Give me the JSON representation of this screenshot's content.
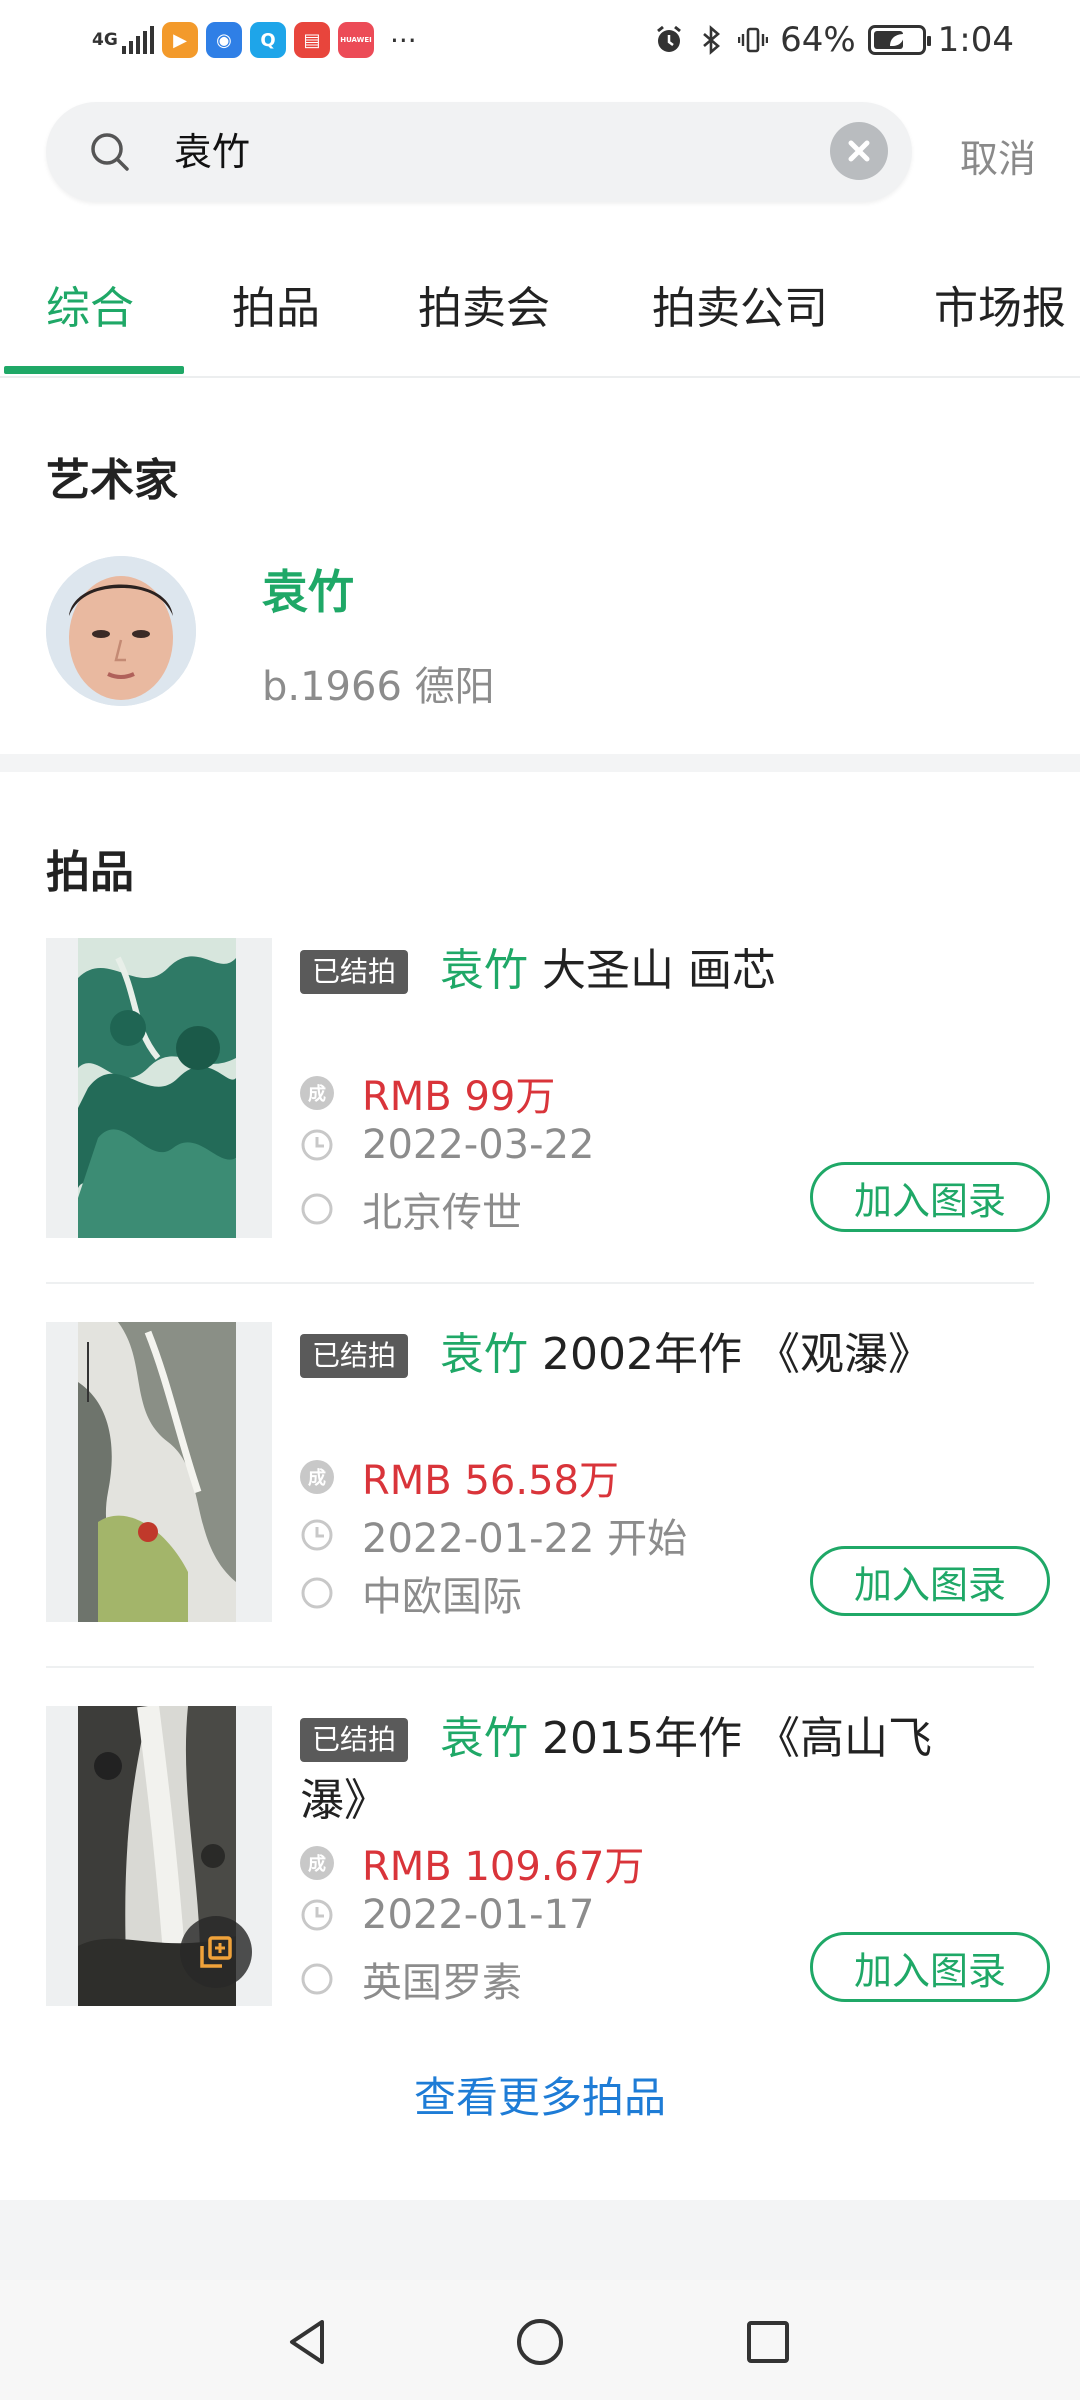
{
  "status_bar": {
    "network": "4G",
    "battery_percent": "64%",
    "battery_level": 0.64,
    "time": "1:04",
    "more": "···",
    "app_icons": [
      "video-app-icon",
      "bulb-app-icon",
      "search-app-icon",
      "reader-app-icon",
      "huawei-app-icon"
    ],
    "app_icon_text": [
      "▶",
      "💡",
      "Q",
      "▌▌",
      "HUAWEI"
    ],
    "app_icon_colors": [
      "#f39a2b",
      "#2f7fe6",
      "#1ea5e9",
      "#e8453c",
      "#ec4b57"
    ]
  },
  "search": {
    "value": "袁竹",
    "cancel_label": "取消"
  },
  "tabs": [
    {
      "label": "综合",
      "active": true
    },
    {
      "label": "拍品",
      "active": false
    },
    {
      "label": "拍卖会",
      "active": false
    },
    {
      "label": "拍卖公司",
      "active": false
    },
    {
      "label": "市场报",
      "active": false
    }
  ],
  "artist_section": {
    "title": "艺术家",
    "name": "袁竹",
    "meta": "b.1966   德阳"
  },
  "lots_section": {
    "title": "拍品",
    "badge": "已结拍",
    "add_label": "加入图录",
    "more_label": "查看更多拍品",
    "items": [
      {
        "highlight": "袁竹",
        "title": " 大圣山 画芯",
        "price": "RMB 99万",
        "date": "2022-03-22",
        "house": "北京传世"
      },
      {
        "highlight": "袁竹",
        "title": " 2002年作 《观瀑》",
        "price": "RMB 56.58万",
        "date": "2022-01-22 开始",
        "house": "中欧国际"
      },
      {
        "highlight": "袁竹",
        "title": " 2015年作 《高山飞瀑》",
        "price": "RMB 109.67万",
        "date": "2022-01-17",
        "house": "英国罗素"
      }
    ]
  },
  "colors": {
    "accent": "#1fa867",
    "price": "#d9343a",
    "link": "#1e7cd6"
  }
}
